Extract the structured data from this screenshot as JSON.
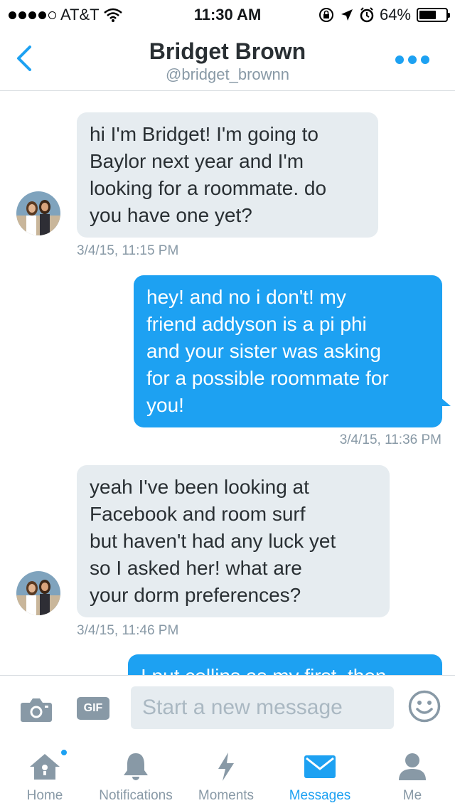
{
  "status_bar": {
    "carrier": "AT&T",
    "signal_bars_filled": 4,
    "signal_bars_total": 5,
    "time": "11:30 AM",
    "battery_percent": "64%",
    "battery_level": 0.64
  },
  "header": {
    "title": "Bridget Brown",
    "handle": "@bridget_brownn"
  },
  "messages": [
    {
      "direction": "in",
      "text_lines": [
        "hi I'm Bridget! I'm going to",
        "Baylor next year and I'm",
        "looking for a roommate. do",
        "you have one yet?"
      ],
      "timestamp": "3/4/15, 11:15 PM"
    },
    {
      "direction": "out",
      "text_lines": [
        "hey! and no i don't! my",
        "friend addyson is a pi phi",
        "and your sister was asking",
        "for a possible roommate for",
        "you!"
      ],
      "timestamp": "3/4/15, 11:36 PM"
    },
    {
      "direction": "in",
      "text_lines": [
        "yeah I've been looking at",
        "Facebook and room surf",
        "but haven't had any luck yet",
        "so I asked her! what are",
        "your dorm preferences?"
      ],
      "timestamp": "3/4/15, 11:46 PM"
    },
    {
      "direction": "out",
      "text_lines": [
        "I put collins as my first, then"
      ]
    }
  ],
  "composer": {
    "gif_label": "GIF",
    "placeholder": "Start a new message",
    "camera_icon": "camera-icon",
    "emoji_icon": "smiley-icon"
  },
  "tabs": [
    {
      "label": "Home",
      "icon": "home-icon",
      "active": false,
      "badge": true
    },
    {
      "label": "Notifications",
      "icon": "bell-icon",
      "active": false,
      "badge": false
    },
    {
      "label": "Moments",
      "icon": "lightning-icon",
      "active": false,
      "badge": false
    },
    {
      "label": "Messages",
      "icon": "envelope-icon",
      "active": true,
      "badge": false
    },
    {
      "label": "Me",
      "icon": "person-icon",
      "active": false,
      "badge": false
    }
  ],
  "colors": {
    "accent": "#1da1f2",
    "incoming_bubble": "#e6ecf0",
    "muted_text": "#8899a6"
  }
}
